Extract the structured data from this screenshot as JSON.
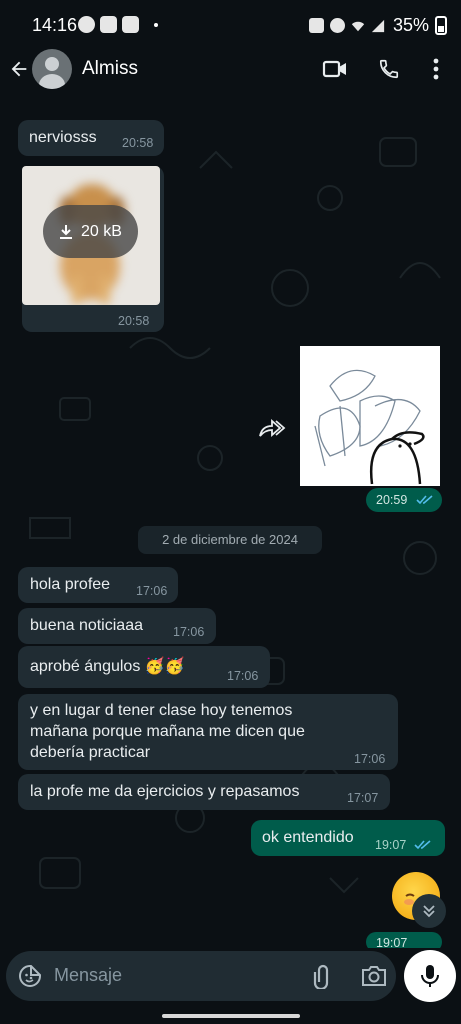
{
  "status_bar": {
    "time": "14:16",
    "battery": "35%"
  },
  "header": {
    "contact_name": "Almiss",
    "icons": [
      "back-arrow-icon",
      "video-call-icon",
      "phone-icon",
      "more-vert-icon"
    ]
  },
  "messages": [
    {
      "text": "nerviosss",
      "time": "20:58",
      "direction": "incoming"
    },
    {
      "type": "image",
      "download_size": "20 kB",
      "time": "20:58",
      "direction": "incoming"
    },
    {
      "type": "sticker",
      "time": "20:59",
      "direction": "outgoing",
      "status": "read"
    },
    {
      "text": "hola profee",
      "time": "17:06",
      "direction": "incoming"
    },
    {
      "text": "buena noticiaaa",
      "time": "17:06",
      "direction": "incoming"
    },
    {
      "text": "aprobé ángulos 🥳🥳",
      "time": "17:06",
      "direction": "incoming"
    },
    {
      "text": "y en lugar d tener clase hoy tenemos\nmañana porque mañana me dicen que\ndebería practicar",
      "time": "17:06",
      "direction": "incoming"
    },
    {
      "text": "la profe me da ejercicios y repasamos",
      "time": "17:07",
      "direction": "incoming"
    },
    {
      "text": "ok entendido",
      "time": "19:07",
      "direction": "outgoing",
      "status": "read"
    },
    {
      "type": "emoji",
      "time": "19:07",
      "direction": "outgoing"
    }
  ],
  "date_separator": "2 de diciembre de 2024",
  "input": {
    "placeholder": "Mensaje"
  },
  "colors": {
    "background": "#0b1014",
    "incoming_bubble": "#202c33",
    "outgoing_bubble": "#005c4b",
    "read_ticks": "#53bdeb"
  }
}
